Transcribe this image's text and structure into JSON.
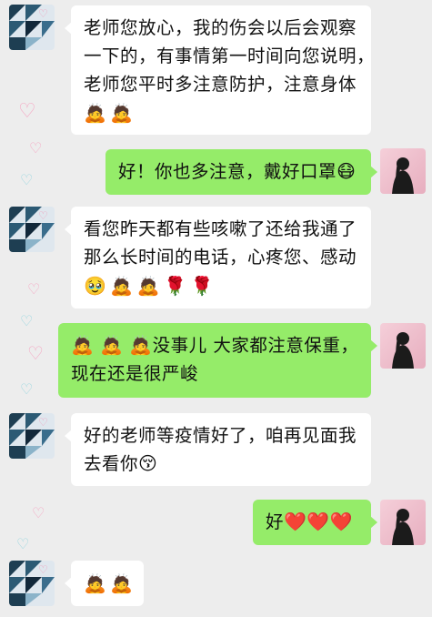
{
  "colors": {
    "background": "#ededed",
    "incoming_bubble": "#ffffff",
    "outgoing_bubble": "#95ec69"
  },
  "decor": {
    "heart_pink": "♡",
    "heart_outline": "♡",
    "tiny": "ᐟ"
  },
  "messages": [
    {
      "side": "incoming",
      "lines": [
        "老师您放心，我的伤会以后会观察",
        "一下的，有事情第一时间向您说明，",
        "老师您平时多注意防护，注意身体"
      ],
      "emojis": [
        "🙇",
        "🙇"
      ]
    },
    {
      "side": "outgoing",
      "text": "好！你也多注意，戴好口罩",
      "emoji": "😷"
    },
    {
      "side": "incoming",
      "lines": [
        "看您昨天都有些咳嗽了还给我通了",
        "那么长时间的电话，心疼您、感动"
      ],
      "emojis": [
        "🥹",
        "🙇",
        "🙇",
        "🌹",
        "🌹"
      ]
    },
    {
      "side": "outgoing",
      "prefix_emojis": [
        "🙇",
        "🙇",
        "🙇"
      ],
      "lines": [
        "没事儿 大家都注意保重，",
        "现在还是很严峻"
      ]
    },
    {
      "side": "incoming",
      "lines": [
        "好的老师等疫情好了，咱再见面我",
        "去看你"
      ],
      "trail_emoji": "😚"
    },
    {
      "side": "outgoing",
      "text": "好",
      "emojis": [
        "❤️",
        "❤️",
        "❤️"
      ]
    },
    {
      "side": "incoming",
      "emojis": [
        "🙇",
        "🙇"
      ]
    }
  ]
}
